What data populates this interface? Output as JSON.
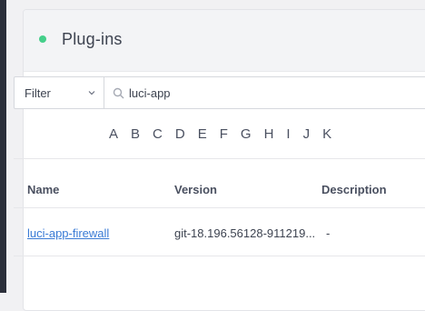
{
  "panel": {
    "title": "Plug-ins",
    "status_color": "#44cf8a"
  },
  "filter": {
    "select_value": "Filter",
    "search_value": "luci-app"
  },
  "alphabet": [
    "A",
    "B",
    "C",
    "D",
    "E",
    "F",
    "G",
    "H",
    "I",
    "J",
    "K"
  ],
  "table": {
    "columns": [
      "Name",
      "Version",
      "Description"
    ],
    "rows": [
      {
        "name": "luci-app-firewall",
        "version": "git-18.196.56128-911219...",
        "description": "-"
      }
    ]
  }
}
